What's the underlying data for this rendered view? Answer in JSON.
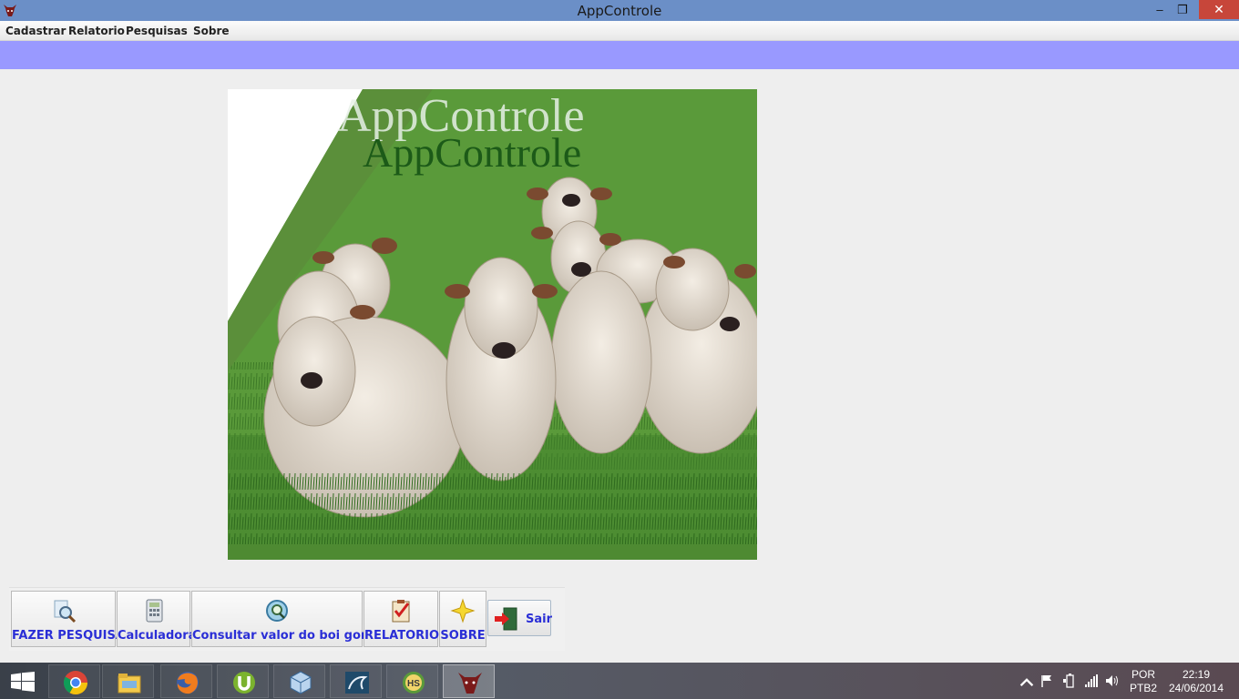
{
  "window": {
    "title": "AppControle",
    "minimize": "‒",
    "maximize": "❐",
    "close": "✕"
  },
  "menu": [
    "Cadastrar",
    "Relatorio",
    "Pesquisas",
    "Sobre"
  ],
  "hero": {
    "brand_text": "AppControle",
    "brand_shadow_text": "AppControle",
    "image_subject": "white nelore cattle herd in green pasture"
  },
  "toolbar": {
    "buttons": [
      {
        "label": "FAZER PESQUISA",
        "icon": "magnifier-document-icon"
      },
      {
        "label": "Calculadora",
        "icon": "calculator-icon"
      },
      {
        "label": "Consultar valor do boi gordo",
        "icon": "search-globe-icon"
      },
      {
        "label": "RELATORIO",
        "icon": "clipboard-check-icon"
      },
      {
        "label": "SOBRE",
        "icon": "star-icon"
      }
    ],
    "exit_label": "Sair",
    "exit_icon": "exit-door-icon",
    "label_color": "#2a2ed6"
  },
  "taskbar": {
    "apps": [
      "chrome-icon",
      "file-explorer-icon",
      "firefox-icon",
      "utorrent-icon",
      "virtualbox-icon",
      "mysql-icon",
      "hs-icon",
      "appcontrole-bull-icon"
    ],
    "language": "POR",
    "keyboard": "PTB2",
    "time": "22:19",
    "date": "24/06/2014"
  },
  "colors": {
    "titlebar": "#6b8fc7",
    "band": "#9999ff",
    "close": "#c7463a"
  }
}
